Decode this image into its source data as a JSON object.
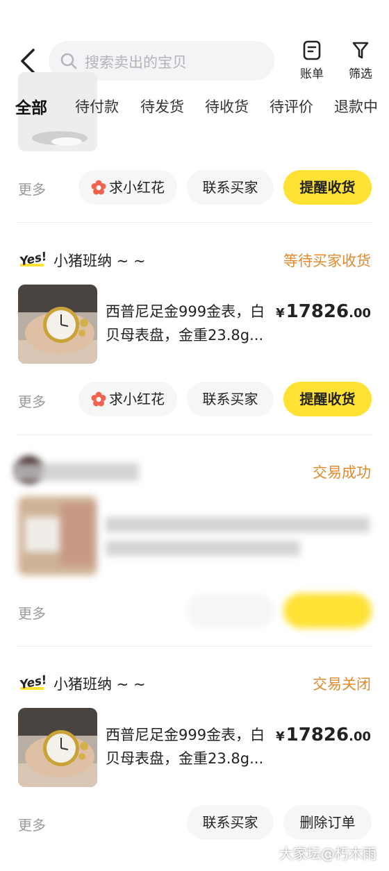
{
  "header": {
    "search_placeholder": "搜索卖出的宝贝",
    "bill_label": "账单",
    "filter_label": "筛选"
  },
  "tabs": [
    "全部",
    "待付款",
    "待发货",
    "待收货",
    "待评价",
    "退款中"
  ],
  "partial_card": {
    "more": "更多",
    "buttons": [
      "求小红花",
      "联系买家",
      "提醒收货"
    ]
  },
  "orders": [
    {
      "shop_name": "小猪班纳 ~ ~",
      "status": "等待买家收货",
      "title": "西普尼足金999金表，白贝母表盘，金重23.8g...",
      "price_currency": "¥",
      "price_int": "17826",
      "price_dec": ".00",
      "more": "更多",
      "buttons": [
        "求小红花",
        "联系买家",
        "提醒收货"
      ]
    },
    {
      "shop_name": "",
      "status": "交易成功",
      "title": "",
      "more": "更多",
      "buttons": [
        "",
        ""
      ]
    },
    {
      "shop_name": "小猪班纳 ~ ~",
      "status": "交易关闭",
      "title": "西普尼足金999金表，白贝母表盘，金重23.8g...",
      "price_currency": "¥",
      "price_int": "17826",
      "price_dec": ".00",
      "more": "更多",
      "buttons": [
        "联系买家",
        "删除订单"
      ]
    }
  ],
  "watermark": "大家坛@朽木雨",
  "colors": {
    "accent_yellow": "#ffe233",
    "status_orange": "#e08a2c",
    "muted_gray": "#9a9a9a"
  },
  "icons": [
    "back-icon",
    "search-icon",
    "bill-icon",
    "filter-icon",
    "flower-icon",
    "yes-logo-icon"
  ]
}
